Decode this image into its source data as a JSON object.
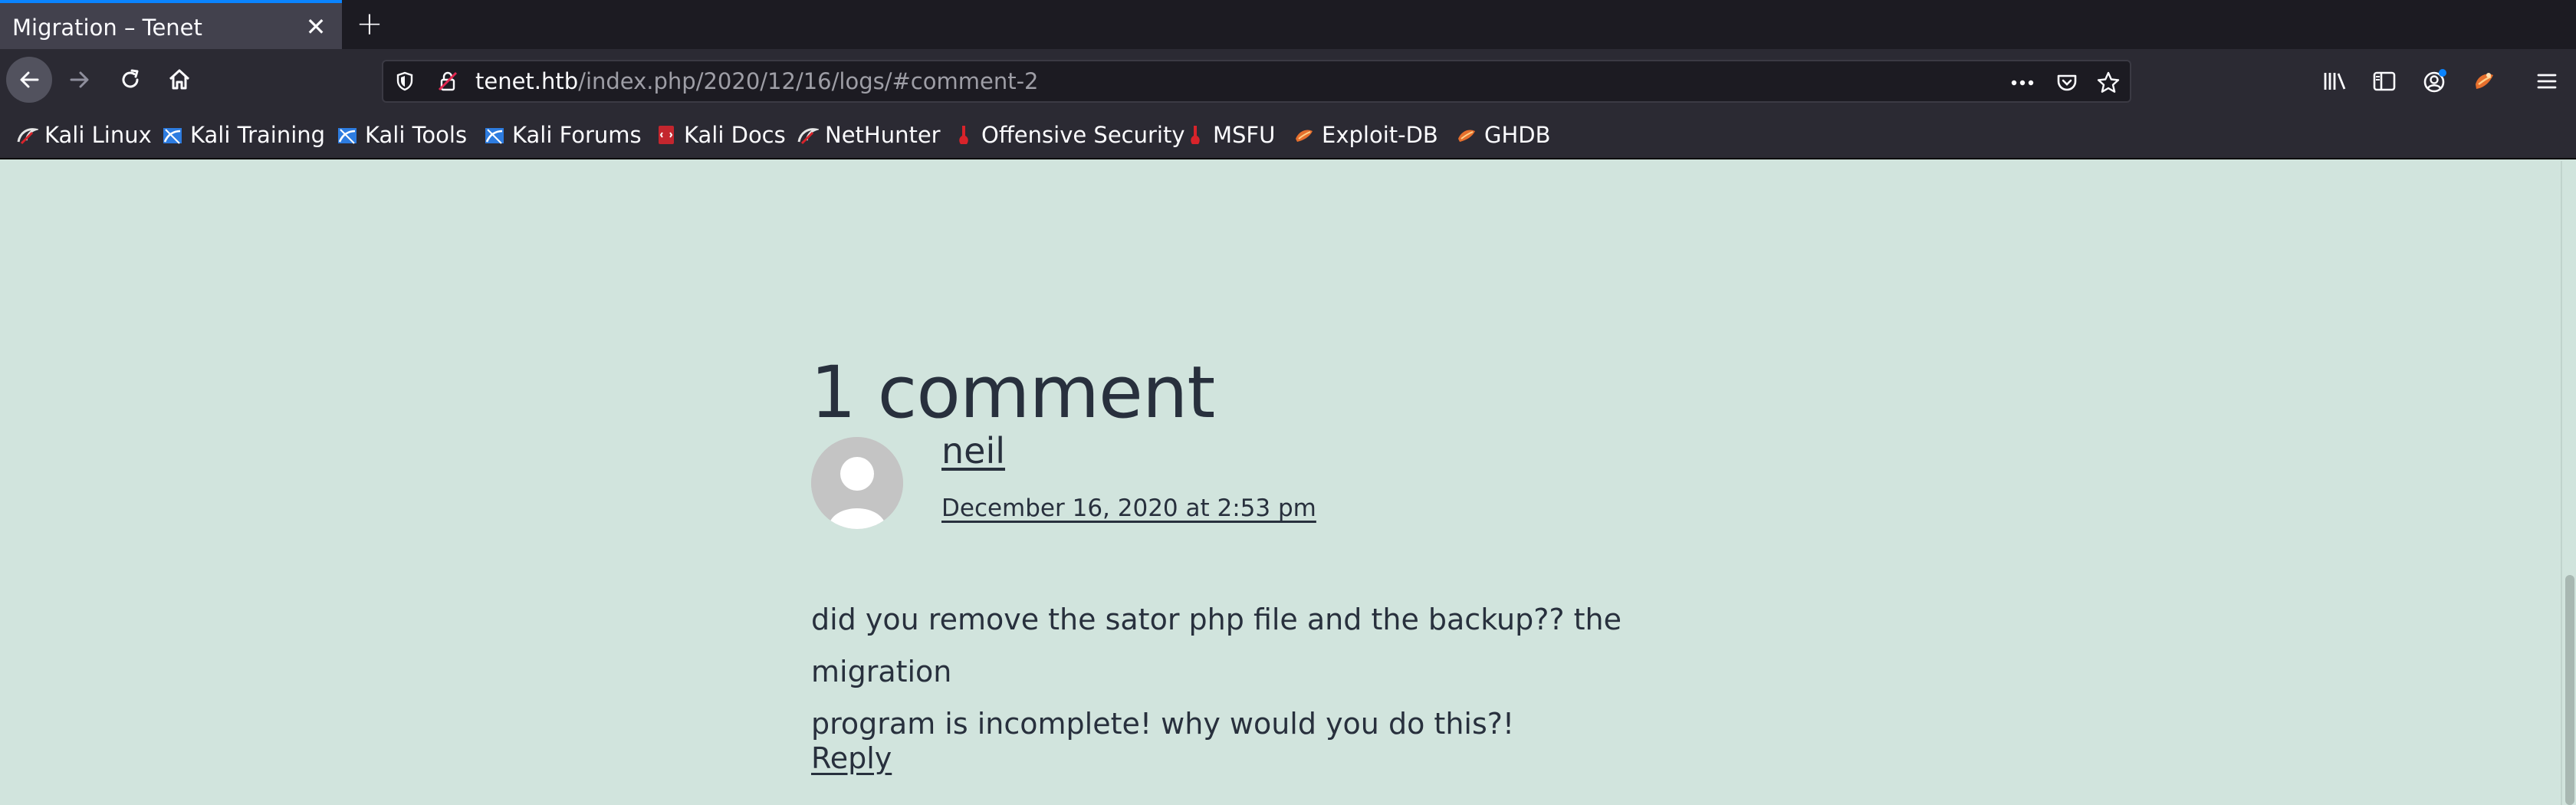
{
  "browser": {
    "tab": {
      "title": "Migration – Tenet",
      "close_symbol": "✕"
    },
    "new_tab_symbol": "+",
    "url": {
      "host": "tenet.htb",
      "path": "/index.php/2020/12/16/logs/#comment-2"
    },
    "nav_icons": [
      "back-icon",
      "forward-icon",
      "reload-icon",
      "home-icon"
    ],
    "url_icons": [
      "tracking-protection-shield-icon",
      "insecure-lock-icon",
      "page-actions-icon",
      "pocket-icon",
      "bookmark-star-icon"
    ],
    "toolbar_icons": [
      "library-icon",
      "sidebar-icon",
      "account-icon",
      "extension-icon",
      "menu-icon"
    ]
  },
  "bookmarks": [
    {
      "label": "Kali Linux",
      "icon": "kali-dragon-icon"
    },
    {
      "label": "Kali Training",
      "icon": "kali-training-icon"
    },
    {
      "label": "Kali Tools",
      "icon": "kali-tools-icon"
    },
    {
      "label": "Kali Forums",
      "icon": "kali-forums-icon"
    },
    {
      "label": "Kali Docs",
      "icon": "kali-docs-icon"
    },
    {
      "label": "NetHunter",
      "icon": "nethunter-icon"
    },
    {
      "label": "Offensive Security",
      "icon": "offsec-icon"
    },
    {
      "label": "MSFU",
      "icon": "msfu-icon"
    },
    {
      "label": "Exploit-DB",
      "icon": "exploit-db-icon"
    },
    {
      "label": "GHDB",
      "icon": "ghdb-icon"
    }
  ],
  "page": {
    "comments_title": "1 comment",
    "comment": {
      "author": "neil",
      "date": "December 16, 2020 at 2:53 pm",
      "body_line1": "did you remove the sator php file and the backup?? the migration",
      "body_line2": "program is incomplete! why would you do this?!",
      "reply_label": "Reply"
    }
  },
  "colors": {
    "page_background": "#d1e4dd",
    "text": "#28303d",
    "browser_chrome": "#2b2a33",
    "tab_accent": "#0a84ff"
  }
}
